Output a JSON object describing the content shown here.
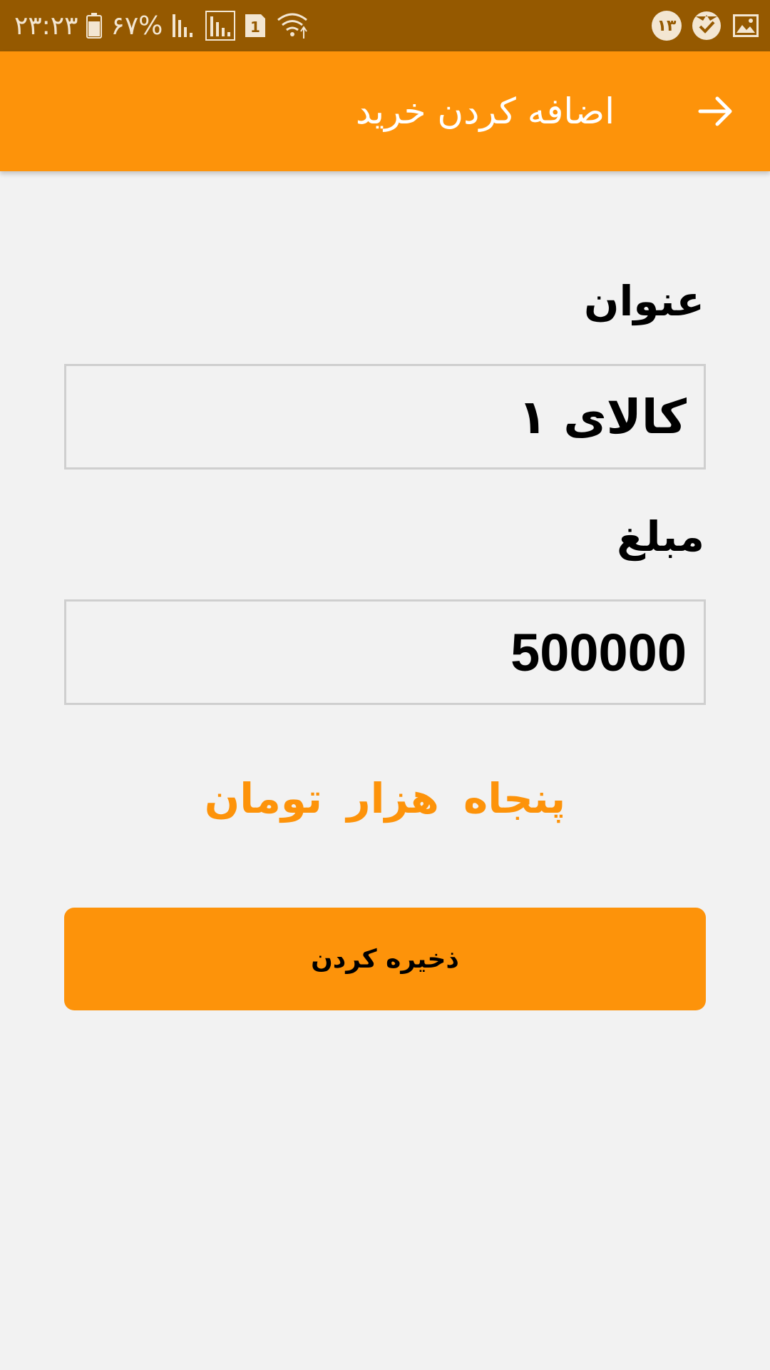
{
  "status_bar": {
    "time": "۲۳:۲۳",
    "battery_percent": "۶۷%",
    "sim_number": "1",
    "notification_count": "۱۳",
    "icons": [
      "battery-icon",
      "signal-icon",
      "signal-outline-icon",
      "sim-icon",
      "wifi-icon",
      "check-shield-icon",
      "image-icon"
    ]
  },
  "app_bar": {
    "title": "اضافه کردن خرید",
    "back_icon": "arrow-right-icon"
  },
  "form": {
    "title_label": "عنوان",
    "title_value": "کالای ۱",
    "amount_label": "مبلغ",
    "amount_value": "500000"
  },
  "amount_in_words": "پنجاه هزار تومان",
  "save_button": {
    "label": "ذخیره کردن"
  },
  "colors": {
    "status_bar": "#955900",
    "accent": "#fd930a",
    "background": "#f2f2f2"
  }
}
